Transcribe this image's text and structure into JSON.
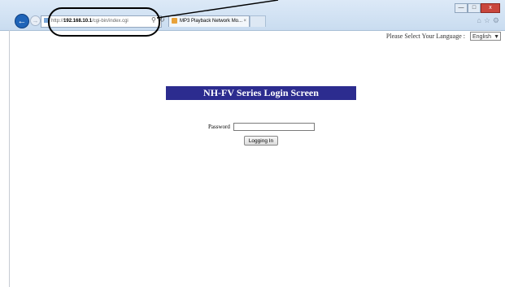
{
  "browser": {
    "address": {
      "prefix": "http://",
      "host": "192.168.10.1",
      "path": "/cgi-bin/index.cgi"
    },
    "tab": {
      "title": "MP3 Playback Network Mo...",
      "close_glyph": "×"
    },
    "window_controls": {
      "minimize": "—",
      "maximize": "□",
      "close": "x"
    },
    "toolbar_icons": [
      "home-icon",
      "star-icon",
      "gear-icon"
    ]
  },
  "language": {
    "label": "Please Select Your Language :",
    "selected": "English"
  },
  "login": {
    "title": "NH-FV Series Login Screen",
    "password_label": "Password",
    "password_value": "",
    "submit_label": "Logging In"
  },
  "colors": {
    "title_bar": "#2c2c8f",
    "chrome": "#c9dcf0"
  }
}
